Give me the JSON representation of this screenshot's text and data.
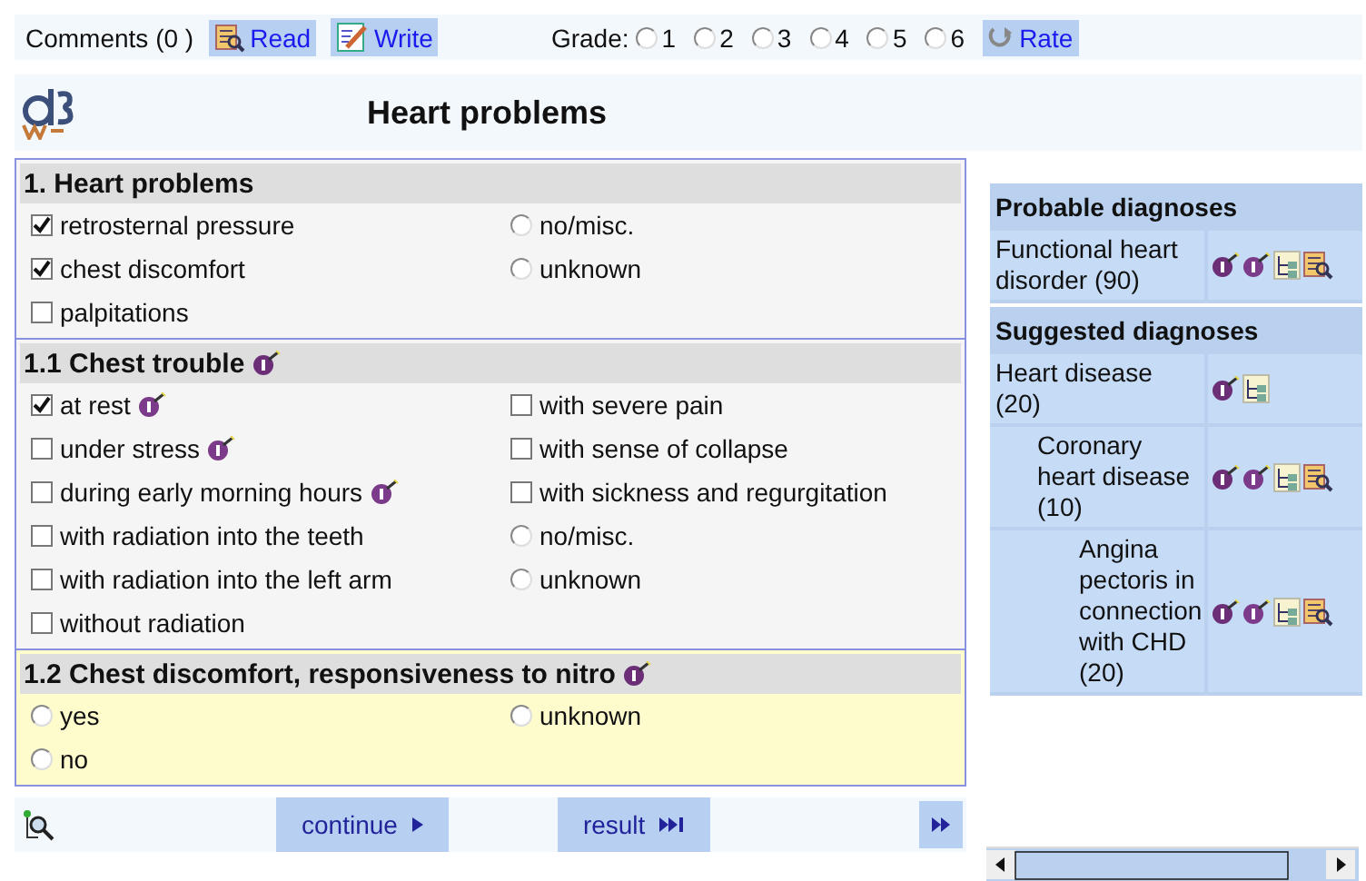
{
  "top_bar": {
    "comments": "Comments (0 )",
    "read": "Read",
    "write": "Write",
    "grade_label": "Grade:",
    "grades": [
      {
        "label": "1",
        "selected": false
      },
      {
        "label": "2",
        "selected": false
      },
      {
        "label": "3",
        "selected": false
      },
      {
        "label": "4",
        "selected": false
      },
      {
        "label": "5",
        "selected": false
      },
      {
        "label": "6",
        "selected": false
      }
    ],
    "rate": "Rate"
  },
  "header": {
    "title": "Heart problems"
  },
  "sections": [
    {
      "title": "1. Heart problems",
      "explanation": false,
      "highlighted": false,
      "left": [
        {
          "kind": "checkbox",
          "label": "retrosternal pressure",
          "checked": true,
          "info": false
        },
        {
          "kind": "checkbox",
          "label": "chest discomfort",
          "checked": true,
          "info": false
        },
        {
          "kind": "checkbox",
          "label": "palpitations",
          "checked": false,
          "info": false
        }
      ],
      "right": [
        {
          "kind": "radio",
          "label": "no/misc.",
          "checked": false,
          "info": false
        },
        {
          "kind": "radio",
          "label": "unknown",
          "checked": false,
          "info": false
        }
      ]
    },
    {
      "title": "1.1 Chest trouble",
      "explanation": true,
      "highlighted": false,
      "left": [
        {
          "kind": "checkbox",
          "label": "at rest",
          "checked": true,
          "info": true
        },
        {
          "kind": "checkbox",
          "label": "under stress",
          "checked": false,
          "info": true
        },
        {
          "kind": "checkbox",
          "label": "during early morning hours",
          "checked": false,
          "info": true
        },
        {
          "kind": "checkbox",
          "label": "with radiation into the teeth",
          "checked": false,
          "info": false
        },
        {
          "kind": "checkbox",
          "label": "with radiation into the left arm",
          "checked": false,
          "info": false
        },
        {
          "kind": "checkbox",
          "label": "without radiation",
          "checked": false,
          "info": false
        }
      ],
      "right": [
        {
          "kind": "checkbox",
          "label": "with severe pain",
          "checked": false,
          "info": false
        },
        {
          "kind": "checkbox",
          "label": "with sense of collapse",
          "checked": false,
          "info": false
        },
        {
          "kind": "checkbox",
          "label": "with sickness and regurgitation",
          "checked": false,
          "info": false
        },
        {
          "kind": "radio",
          "label": "no/misc.",
          "checked": false,
          "info": false
        },
        {
          "kind": "radio",
          "label": "unknown",
          "checked": false,
          "info": false
        }
      ]
    },
    {
      "title": "1.2 Chest discomfort, responsiveness to nitro",
      "explanation": true,
      "highlighted": true,
      "left": [
        {
          "kind": "radio",
          "label": "yes",
          "checked": false,
          "info": false
        },
        {
          "kind": "radio",
          "label": "no",
          "checked": false,
          "info": false
        }
      ],
      "right": [
        {
          "kind": "radio",
          "label": "unknown",
          "checked": false,
          "info": false
        }
      ]
    }
  ],
  "navigation": {
    "continue": "continue",
    "result": "result"
  },
  "diagnoses": [
    {
      "title": "Probable diagnoses",
      "items": [
        {
          "label": "Functional heart disorder (90)",
          "explain": true,
          "info": true,
          "tree": true,
          "read": true
        }
      ]
    },
    {
      "title": "Suggested diagnoses",
      "items": [
        {
          "label": "Heart disease (20)",
          "explain": true,
          "info": false,
          "tree": true,
          "read": false,
          "children": [
            {
              "label": "Coronary heart disease (10)",
              "explain": true,
              "info": true,
              "tree": true,
              "read": true,
              "children": [
                {
                  "label": "Angina pectoris in connection with CHD (20)",
                  "explain": true,
                  "info": true,
                  "tree": true,
                  "read": true
                }
              ]
            }
          ]
        }
      ]
    }
  ]
}
